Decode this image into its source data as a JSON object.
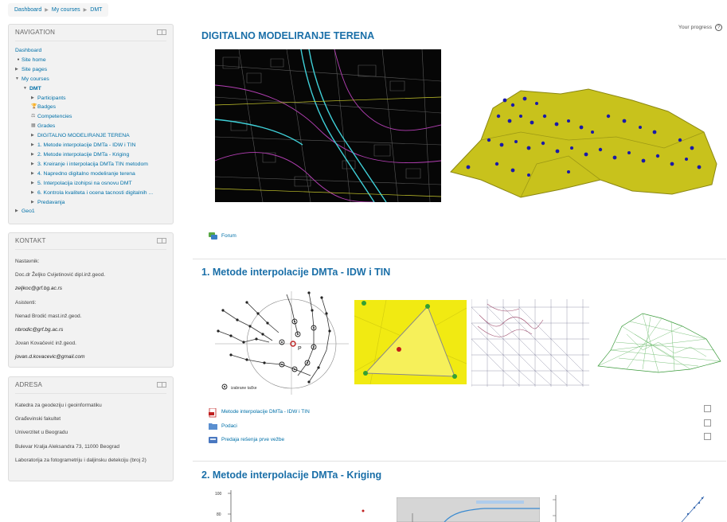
{
  "breadcrumb": [
    "Dashboard",
    "My courses",
    "DMT"
  ],
  "navigation": {
    "title": "NAVIGATION",
    "items": [
      {
        "label": "Dashboard",
        "level": 0,
        "marker": "none"
      },
      {
        "label": "Site home",
        "level": 1,
        "marker": "bullet"
      },
      {
        "label": "Site pages",
        "level": 1,
        "marker": "tri-right"
      },
      {
        "label": "My courses",
        "level": 1,
        "marker": "tri-down"
      },
      {
        "label": "DMT",
        "level": 2,
        "marker": "tri-down",
        "bold": true
      },
      {
        "label": "Participants",
        "level": 3,
        "marker": "tri-right"
      },
      {
        "label": "Badges",
        "level": 3,
        "marker": "icon",
        "icon": "badge-icon"
      },
      {
        "label": "Competencies",
        "level": 3,
        "marker": "icon",
        "icon": "competency-icon"
      },
      {
        "label": "Grades",
        "level": 3,
        "marker": "icon",
        "icon": "grades-icon"
      },
      {
        "label": "DIGITALNO MODELIRANJE TERENA",
        "level": 3,
        "marker": "tri-right"
      },
      {
        "label": "1. Metode interpolacije DMTa - IDW i TIN",
        "level": 3,
        "marker": "tri-right"
      },
      {
        "label": "2. Metode interpolacije DMTa - Kriging",
        "level": 3,
        "marker": "tri-right"
      },
      {
        "label": "3. Kreiranje i interpolacija DMTa TIN metodom",
        "level": 3,
        "marker": "tri-right"
      },
      {
        "label": "4. Napredno digitalno modeliranje terena",
        "level": 3,
        "marker": "tri-right"
      },
      {
        "label": "5. Interpolacija izohipsi na osnovu DMT",
        "level": 3,
        "marker": "tri-right"
      },
      {
        "label": "6. Kontrola kvaliteta i ocena tacnosti digitalnih ...",
        "level": 3,
        "marker": "tri-right"
      },
      {
        "label": "Predavanja",
        "level": 3,
        "marker": "tri-right"
      },
      {
        "label": "Geo1",
        "level": 1,
        "marker": "tri-right"
      }
    ]
  },
  "kontakt": {
    "title": "KONTAKT",
    "lines": [
      {
        "text": "Nastavnik:",
        "mail": false
      },
      {
        "text": "Doc.dr Željko Cvijetinović dipl.inž.geod.",
        "mail": false
      },
      {
        "text": "zeljkoc@grf.bg.ac.rs",
        "mail": true
      },
      {
        "text": "Asistenti:",
        "mail": false
      },
      {
        "text": "Nenad Brodić mast.inž.geod.",
        "mail": false
      },
      {
        "text": "nbrodic@grf.bg.ac.rs",
        "mail": true
      },
      {
        "text": "Jovan Kovačević inž.geod.",
        "mail": false
      },
      {
        "text": "jovan.d.kovacevic@gmail.com",
        "mail": true
      }
    ]
  },
  "adresa": {
    "title": "ADRESA",
    "lines": [
      "Katedra za geodeziju i geoinformatiku",
      "Građevinski fakultet",
      "Univerzitet u Beogradu",
      "Bulevar Kralja Aleksandra 73, 11000 Beograd",
      "Laboratorija za fotogrametriju i daljinsku detekciju (broj 2)"
    ]
  },
  "main": {
    "progress_label": "Your progress",
    "progress_help": "?",
    "section0": {
      "title": "DIGITALNO MODELIRANJE TERENA",
      "forum_label": "Forum"
    },
    "section1": {
      "title": "1. Metode interpolacije DMTa - IDW i TIN",
      "diagram_point_label": "P",
      "diagram_legend": "izabrane tačke",
      "activities": [
        {
          "label": "Metode interpolacije DMTa - IDW i TIN",
          "icon": "pdf-icon"
        },
        {
          "label": "Podaci",
          "icon": "folder-icon"
        },
        {
          "label": "Predaja rešenja prve vežbe",
          "icon": "assignment-icon"
        }
      ]
    },
    "section2": {
      "title": "2. Metode interpolacije DMTa - Kriging",
      "axis_ticks": [
        "100",
        "80"
      ]
    }
  },
  "colors": {
    "link": "#0070a8",
    "title": "#1a6fa8",
    "block_bg": "#f2f2f2",
    "terrain_yellow": "#c8c21c",
    "tin_yellow": "#f1ea12"
  }
}
